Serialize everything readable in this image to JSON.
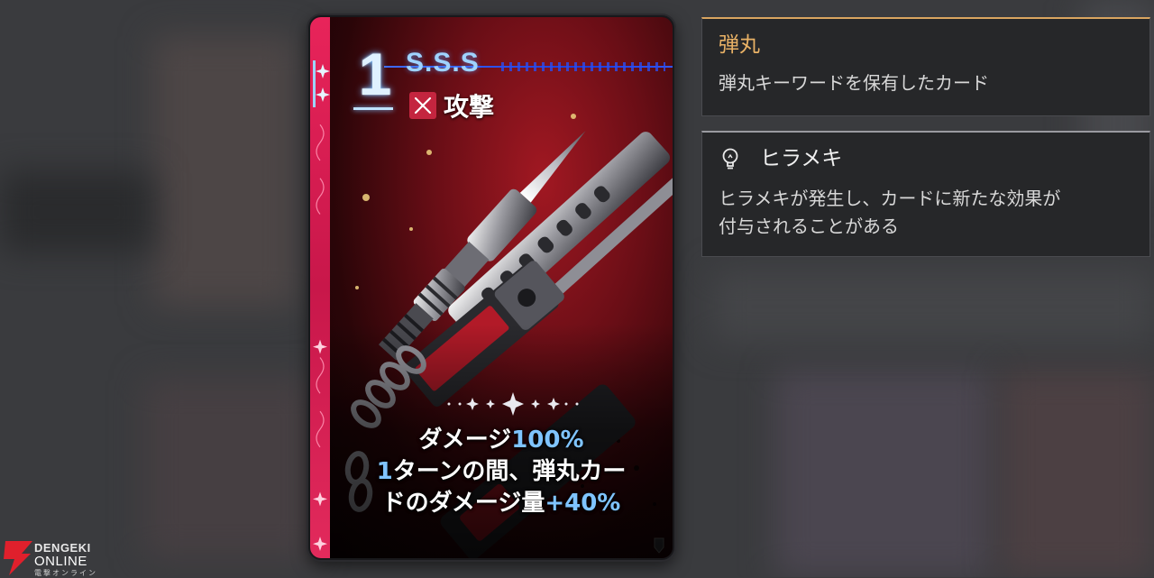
{
  "card": {
    "cost": "1",
    "name": "S.S.S",
    "type_label": "攻撃",
    "type_icon": "crossed-swords-icon",
    "description": {
      "line1_prefix": "ダメージ",
      "line1_value": "100%",
      "line2_value": "1",
      "line2_suffix": "ターンの間、弾丸カー",
      "line3_prefix": "ドのダメージ量",
      "line3_value": "+40%"
    },
    "colors": {
      "stripe": "#e8245a",
      "cost_glow": "#6bb8ff",
      "highlight": "#7fc4ff",
      "background": "#a11822"
    }
  },
  "tooltips": [
    {
      "title": "弾丸",
      "body": "弾丸キーワードを保有したカード",
      "title_color": "#e9b266"
    },
    {
      "icon": "lightbulb-icon",
      "title": "ヒラメキ",
      "body_line1": "ヒラメキが発生し、カードに新たな効果が",
      "body_line2": "付与されることがある"
    }
  ],
  "watermark": {
    "line1": "DENGEKI",
    "line2": "ONLINE",
    "line3": "電撃オンライン"
  }
}
